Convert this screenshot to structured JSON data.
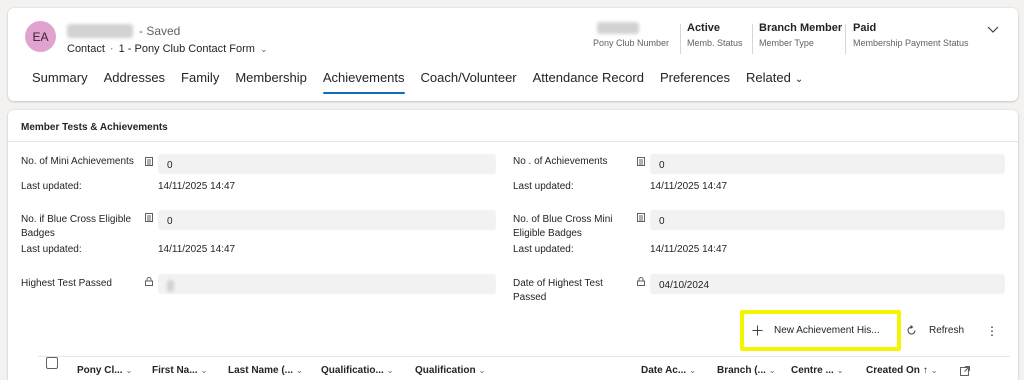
{
  "header": {
    "avatar_initials": "EA",
    "saved_status": "- Saved",
    "entity": "Contact",
    "form": "1 - Pony Club Contact Form",
    "fields": [
      {
        "value": "",
        "label": "Pony Club Number"
      },
      {
        "value": "Active",
        "label": "Memb. Status"
      },
      {
        "value": "Branch Member",
        "label": "Member Type"
      },
      {
        "value": "Paid",
        "label": "Membership Payment Status"
      }
    ]
  },
  "tabs": [
    {
      "label": "Summary"
    },
    {
      "label": "Addresses"
    },
    {
      "label": "Family"
    },
    {
      "label": "Membership"
    },
    {
      "label": "Achievements",
      "active": true
    },
    {
      "label": "Coach/Volunteer"
    },
    {
      "label": "Attendance Record"
    },
    {
      "label": "Preferences"
    },
    {
      "label": "Related"
    }
  ],
  "section": {
    "title": "Member Tests & Achievements",
    "left": {
      "mini_label": "No. of Mini Achievements",
      "mini_value": "0",
      "mini_updated_label": "Last updated:",
      "mini_updated_value": "14/11/2025 14:47",
      "blue_label_1": "No. if Blue Cross Eligible",
      "blue_label_2": "Badges",
      "blue_value": "0",
      "blue_updated_label": "Last updated:",
      "blue_updated_value": "14/11/2025 14:47",
      "highest_label": "Highest Test Passed"
    },
    "right": {
      "ach_label": "No . of Achievements",
      "ach_value": "0",
      "ach_updated_label": "Last updated:",
      "ach_updated_value": "14/11/2025 14:47",
      "bcmini_label_1": "No. of Blue Cross Mini",
      "bcmini_label_2": "Eligible Badges",
      "bcmini_value": "0",
      "bcmini_updated_label": "Last updated:",
      "bcmini_updated_value": "14/11/2025 14:47",
      "date_label_1": "Date of Highest Test",
      "date_label_2": "Passed",
      "date_value": "04/10/2024"
    }
  },
  "commands": {
    "new_achievement": "New Achievement His...",
    "refresh": "Refresh"
  },
  "grid": {
    "columns": [
      "Pony Cl...",
      "First Na...",
      "Last Name (...",
      "Qualificatio...",
      "Qualification",
      "Date Ac...",
      "Branch (...",
      "Centre ...",
      "Created On"
    ]
  },
  "colors": {
    "accent": "#0f6cbd",
    "highlight": "#f5f500",
    "avatar": "#e0a3cf"
  }
}
